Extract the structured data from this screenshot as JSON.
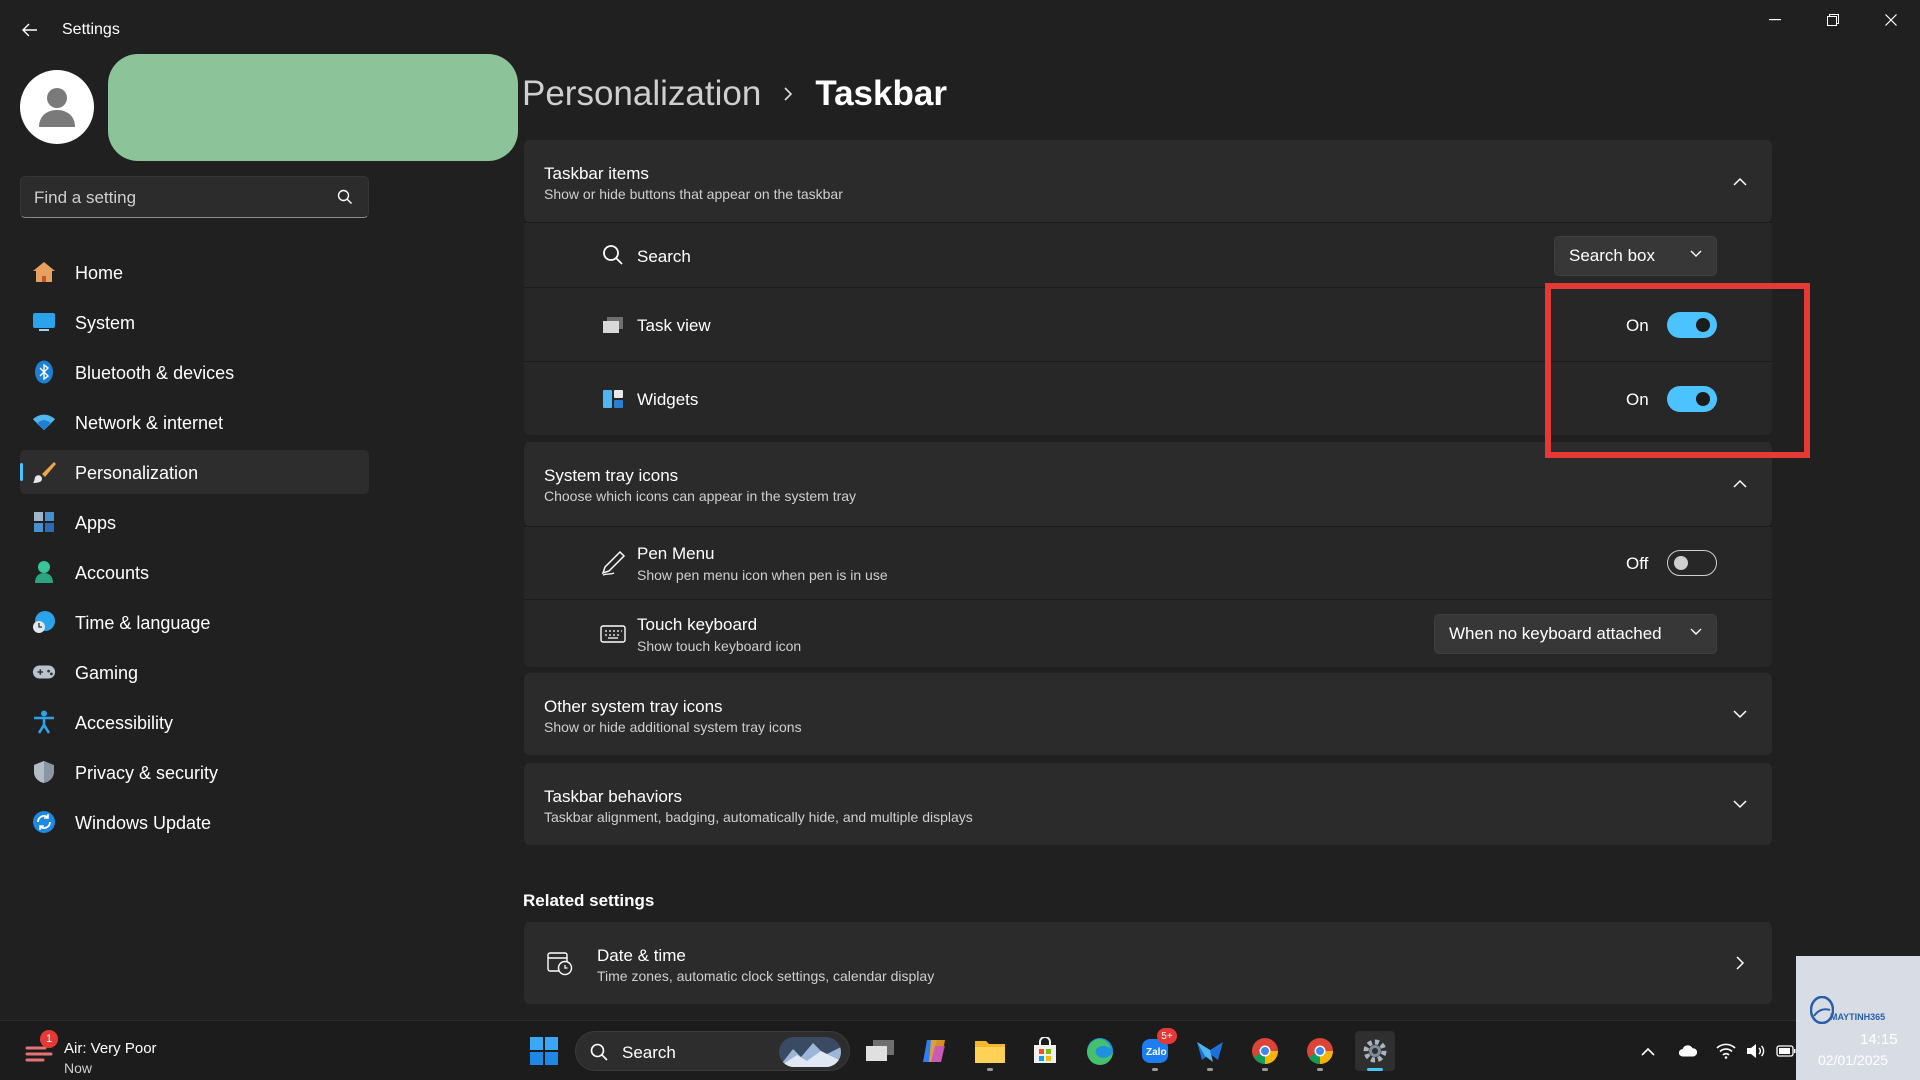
{
  "app": {
    "title": "Settings"
  },
  "search": {
    "placeholder": "Find a setting"
  },
  "nav": [
    {
      "label": "Home",
      "icon": "home-icon"
    },
    {
      "label": "System",
      "icon": "system-icon"
    },
    {
      "label": "Bluetooth & devices",
      "icon": "bluetooth-icon"
    },
    {
      "label": "Network & internet",
      "icon": "wifi-icon"
    },
    {
      "label": "Personalization",
      "icon": "brush-icon",
      "active": true
    },
    {
      "label": "Apps",
      "icon": "apps-icon"
    },
    {
      "label": "Accounts",
      "icon": "account-icon"
    },
    {
      "label": "Time & language",
      "icon": "clock-globe-icon"
    },
    {
      "label": "Gaming",
      "icon": "gamepad-icon"
    },
    {
      "label": "Accessibility",
      "icon": "accessibility-icon"
    },
    {
      "label": "Privacy & security",
      "icon": "shield-icon"
    },
    {
      "label": "Windows Update",
      "icon": "update-icon"
    }
  ],
  "breadcrumb": {
    "parent": "Personalization",
    "current": "Taskbar"
  },
  "taskbar_items": {
    "title": "Taskbar items",
    "subtitle": "Show or hide buttons that appear on the taskbar",
    "search": {
      "label": "Search",
      "value": "Search box"
    },
    "task_view": {
      "label": "Task view",
      "state": "On",
      "on": true
    },
    "widgets": {
      "label": "Widgets",
      "state": "On",
      "on": true
    }
  },
  "system_tray": {
    "title": "System tray icons",
    "subtitle": "Choose which icons can appear in the system tray",
    "pen_menu": {
      "label": "Pen Menu",
      "sub": "Show pen menu icon when pen is in use",
      "state": "Off",
      "on": false
    },
    "touch_keyboard": {
      "label": "Touch keyboard",
      "sub": "Show touch keyboard icon",
      "value": "When no keyboard attached"
    }
  },
  "other_tray": {
    "title": "Other system tray icons",
    "subtitle": "Show or hide additional system tray icons"
  },
  "behaviors": {
    "title": "Taskbar behaviors",
    "subtitle": "Taskbar alignment, badging, automatically hide, and multiple displays"
  },
  "related": {
    "heading": "Related settings",
    "date_time": {
      "title": "Date & time",
      "subtitle": "Time zones, automatic clock settings, calendar display"
    }
  },
  "taskbar": {
    "weather": {
      "badge": "1",
      "title": "Air: Very Poor",
      "sub": "Now"
    },
    "search_label": "Search",
    "zalo_badge": "5+",
    "watermark": "MAYTINH365",
    "time": "14:15",
    "date": "02/01/2025"
  },
  "colors": {
    "accent": "#4cc2ff",
    "highlight": "#e53935",
    "background": "#202020",
    "card": "#2b2b2b"
  }
}
